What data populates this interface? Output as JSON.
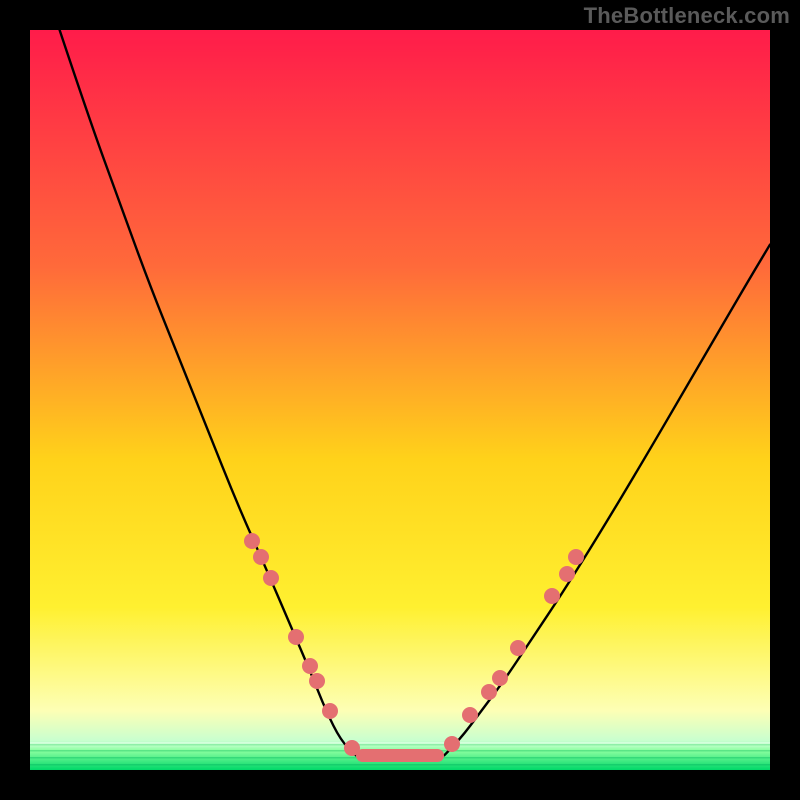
{
  "watermark": "TheBottleneck.com",
  "colors": {
    "gradient_top": "#ff1c4a",
    "gradient_mid1": "#ff6a3a",
    "gradient_mid2": "#ffd21a",
    "gradient_mid3": "#fff030",
    "gradient_pale": "#fdffb5",
    "green_top": "#8cffa0",
    "green_bottom": "#00e070",
    "curve": "#000000",
    "dot": "#e46f71",
    "frame": "#000000"
  },
  "chart_data": {
    "type": "line",
    "title": "",
    "xlabel": "",
    "ylabel": "",
    "xlim": [
      0,
      100
    ],
    "ylim": [
      0,
      100
    ],
    "series": [
      {
        "name": "left-curve",
        "x": [
          4,
          8,
          12,
          16,
          20,
          24,
          28,
          32,
          35,
          38,
          40,
          42,
          44
        ],
        "y": [
          100,
          88,
          77,
          66,
          56,
          46,
          36,
          27,
          20,
          13,
          8,
          4,
          2
        ]
      },
      {
        "name": "right-curve",
        "x": [
          56,
          58,
          61,
          64,
          68,
          72,
          77,
          83,
          90,
          97,
          100
        ],
        "y": [
          2,
          4,
          8,
          12,
          18,
          24,
          32,
          42,
          54,
          66,
          71
        ]
      },
      {
        "name": "flat-bottom",
        "x": [
          44,
          56
        ],
        "y": [
          1.8,
          1.8
        ]
      }
    ],
    "points_left": [
      {
        "x": 30.0,
        "y": 31.0
      },
      {
        "x": 31.2,
        "y": 28.8
      },
      {
        "x": 32.5,
        "y": 26.0
      },
      {
        "x": 36.0,
        "y": 18.0
      },
      {
        "x": 37.8,
        "y": 14.0
      },
      {
        "x": 38.8,
        "y": 12.0
      },
      {
        "x": 40.5,
        "y": 8.0
      },
      {
        "x": 43.5,
        "y": 3.0
      }
    ],
    "points_right": [
      {
        "x": 57.0,
        "y": 3.5
      },
      {
        "x": 59.5,
        "y": 7.5
      },
      {
        "x": 62.0,
        "y": 10.5
      },
      {
        "x": 63.5,
        "y": 12.5
      },
      {
        "x": 66.0,
        "y": 16.5
      },
      {
        "x": 70.5,
        "y": 23.5
      },
      {
        "x": 72.5,
        "y": 26.5
      },
      {
        "x": 73.8,
        "y": 28.8
      }
    ],
    "flat_segment": {
      "x0": 44,
      "x1": 56,
      "y": 2.0
    },
    "annotations": []
  }
}
